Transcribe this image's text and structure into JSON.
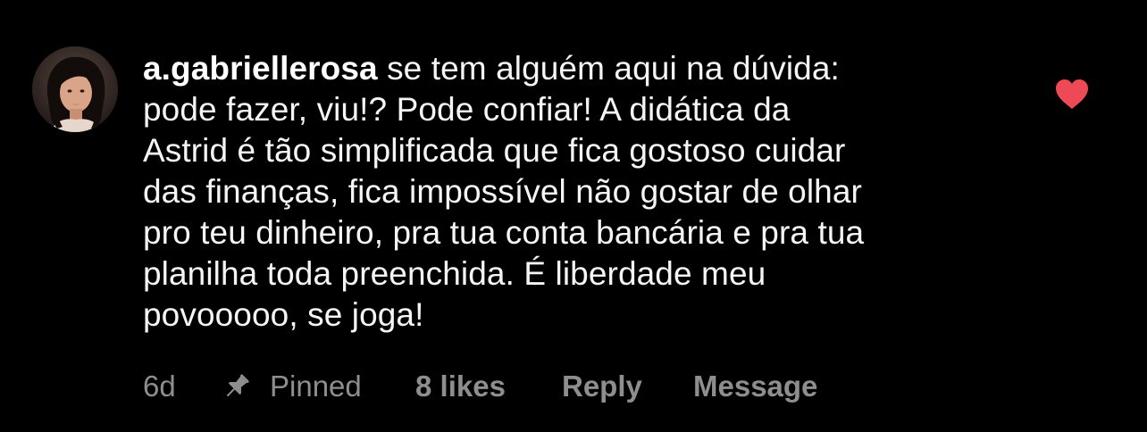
{
  "comment": {
    "username": "a.gabriellerosa",
    "text_lines": [
      " se tem alguém aqui na dúvida:",
      "pode fazer, viu!? Pode confiar! A didática da",
      "Astrid é tão simplificada que fica gostoso cuidar",
      "das finanças, fica impossível não gostar de olhar",
      "pro teu dinheiro, pra tua conta bancária e pra tua",
      "planilha toda preenchida. É liberdade meu",
      "povooooo, se joga!"
    ],
    "liked": true,
    "like_icon": "heart-filled-icon",
    "like_color": "#ed4956"
  },
  "actions": {
    "age": "6d",
    "pin_icon": "pin-icon",
    "pinned_label": "Pinned",
    "likes_label": "8 likes",
    "reply_label": "Reply",
    "message_label": "Message"
  },
  "colors": {
    "background": "#000000",
    "text": "#f5f5f5",
    "secondary_text": "#8e8e8e"
  }
}
